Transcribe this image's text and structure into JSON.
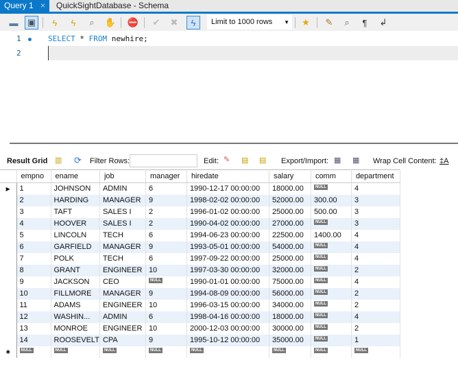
{
  "tabs": [
    {
      "label": "Query 1",
      "close": "×"
    },
    {
      "label": "QuickSightDatabase - Schema"
    }
  ],
  "toolbar": {
    "limit": "Limit to 1000 rows"
  },
  "editor": {
    "lines": [
      {
        "num": "1",
        "kw1": "SELECT",
        "mid": " * ",
        "kw2": "FROM",
        "rest": " newhire;"
      },
      {
        "num": "2"
      }
    ]
  },
  "result_toolbar": {
    "result_grid": "Result Grid",
    "filter_rows": "Filter Rows:",
    "edit": "Edit:",
    "export": "Export/Import:",
    "wrap": "Wrap Cell Content:"
  },
  "null_label": "NULL",
  "columns": [
    "empno",
    "ename",
    "job",
    "manager",
    "hiredate",
    "salary",
    "comm",
    "department"
  ],
  "rows": [
    [
      "1",
      "JOHNSON",
      "ADMIN",
      "6",
      "1990-12-17 00:00:00",
      "18000.00",
      null,
      "4"
    ],
    [
      "2",
      "HARDING",
      "MANAGER",
      "9",
      "1998-02-02 00:00:00",
      "52000.00",
      "300.00",
      "3"
    ],
    [
      "3",
      "TAFT",
      "SALES I",
      "2",
      "1996-01-02 00:00:00",
      "25000.00",
      "500.00",
      "3"
    ],
    [
      "4",
      "HOOVER",
      "SALES I",
      "2",
      "1990-04-02 00:00:00",
      "27000.00",
      null,
      "3"
    ],
    [
      "5",
      "LINCOLN",
      "TECH",
      "6",
      "1994-06-23 00:00:00",
      "22500.00",
      "1400.00",
      "4"
    ],
    [
      "6",
      "GARFIELD",
      "MANAGER",
      "9",
      "1993-05-01 00:00:00",
      "54000.00",
      null,
      "4"
    ],
    [
      "7",
      "POLK",
      "TECH",
      "6",
      "1997-09-22 00:00:00",
      "25000.00",
      null,
      "4"
    ],
    [
      "8",
      "GRANT",
      "ENGINEER",
      "10",
      "1997-03-30 00:00:00",
      "32000.00",
      null,
      "2"
    ],
    [
      "9",
      "JACKSON",
      "CEO",
      null,
      "1990-01-01 00:00:00",
      "75000.00",
      null,
      "4"
    ],
    [
      "10",
      "FILLMORE",
      "MANAGER",
      "9",
      "1994-08-09 00:00:00",
      "56000.00",
      null,
      "2"
    ],
    [
      "11",
      "ADAMS",
      "ENGINEER",
      "10",
      "1996-03-15 00:00:00",
      "34000.00",
      null,
      "2"
    ],
    [
      "12",
      "WASHIN...",
      "ADMIN",
      "6",
      "1998-04-16 00:00:00",
      "18000.00",
      null,
      "4"
    ],
    [
      "13",
      "MONROE",
      "ENGINEER",
      "10",
      "2000-12-03 00:00:00",
      "30000.00",
      null,
      "2"
    ],
    [
      "14",
      "ROOSEVELT",
      "CPA",
      "9",
      "1995-10-12 00:00:00",
      "35000.00",
      null,
      "1"
    ]
  ]
}
